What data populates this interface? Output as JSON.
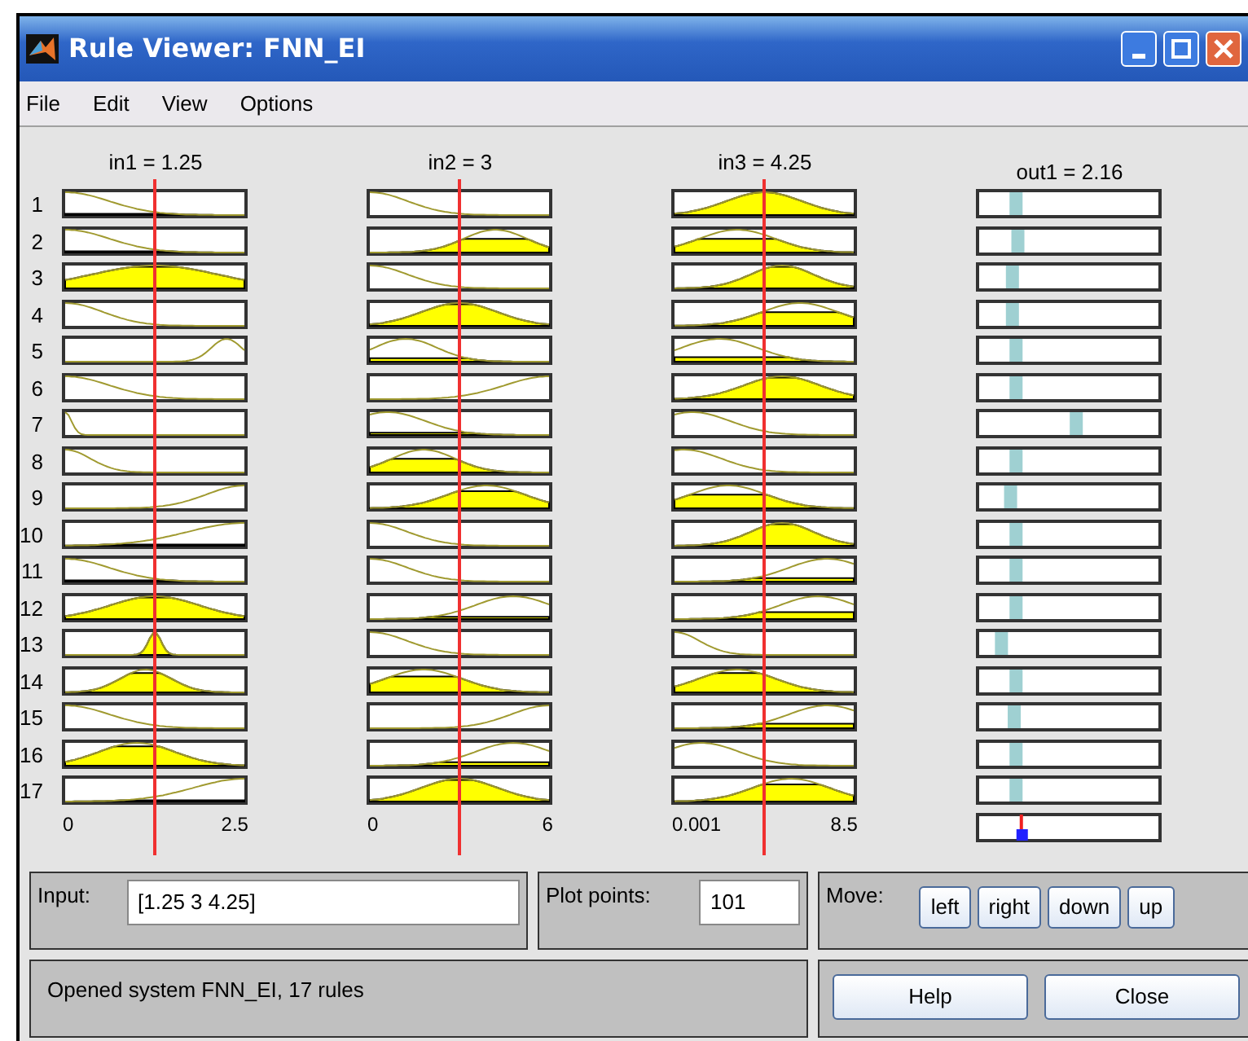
{
  "window": {
    "title": "Rule Viewer: FNN_EI"
  },
  "menu": [
    "File",
    "Edit",
    "View",
    "Options"
  ],
  "rules": [
    "1",
    "2",
    "3",
    "4",
    "5",
    "6",
    "7",
    "8",
    "9",
    "10",
    "11",
    "12",
    "13",
    "14",
    "15",
    "16",
    "17"
  ],
  "columns": [
    {
      "kind": "input",
      "label": "in1 = 1.25",
      "axis_min": "0",
      "axis_max": "2.5"
    },
    {
      "kind": "input",
      "label": "in2 = 3",
      "axis_min": "0",
      "axis_max": "6"
    },
    {
      "kind": "input",
      "label": "in3 = 4.25",
      "axis_min": "0.001",
      "axis_max": "8.5"
    },
    {
      "kind": "output",
      "label": "out1 = 2.16"
    }
  ],
  "input": {
    "label": "Input:",
    "value": "[1.25 3 4.25]"
  },
  "plot_points": {
    "label": "Plot points:",
    "value": "101"
  },
  "move": {
    "label": "Move:",
    "buttons": [
      "left",
      "right",
      "down",
      "up"
    ]
  },
  "status": "Opened system FNN_EI, 17 rules",
  "buttons": [
    "Help",
    "Close"
  ]
}
